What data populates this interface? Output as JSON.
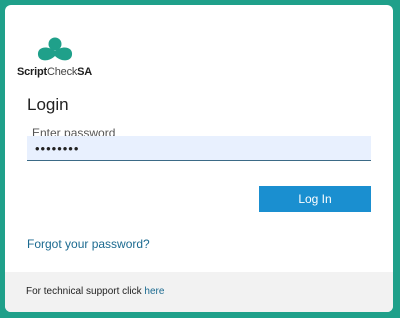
{
  "brand": {
    "logo_icon": "scriptcheck-logo-icon",
    "name_part1": "Script",
    "name_part2": "Check",
    "name_part3": "SA",
    "accent": "#1fa08a"
  },
  "login": {
    "title": "Login",
    "password_label": "Enter password",
    "password_value": "••••••••",
    "submit_label": "Log In",
    "forgot_link": "Forgot your password?"
  },
  "footer": {
    "support_text": "For technical support click ",
    "support_link": "here"
  }
}
